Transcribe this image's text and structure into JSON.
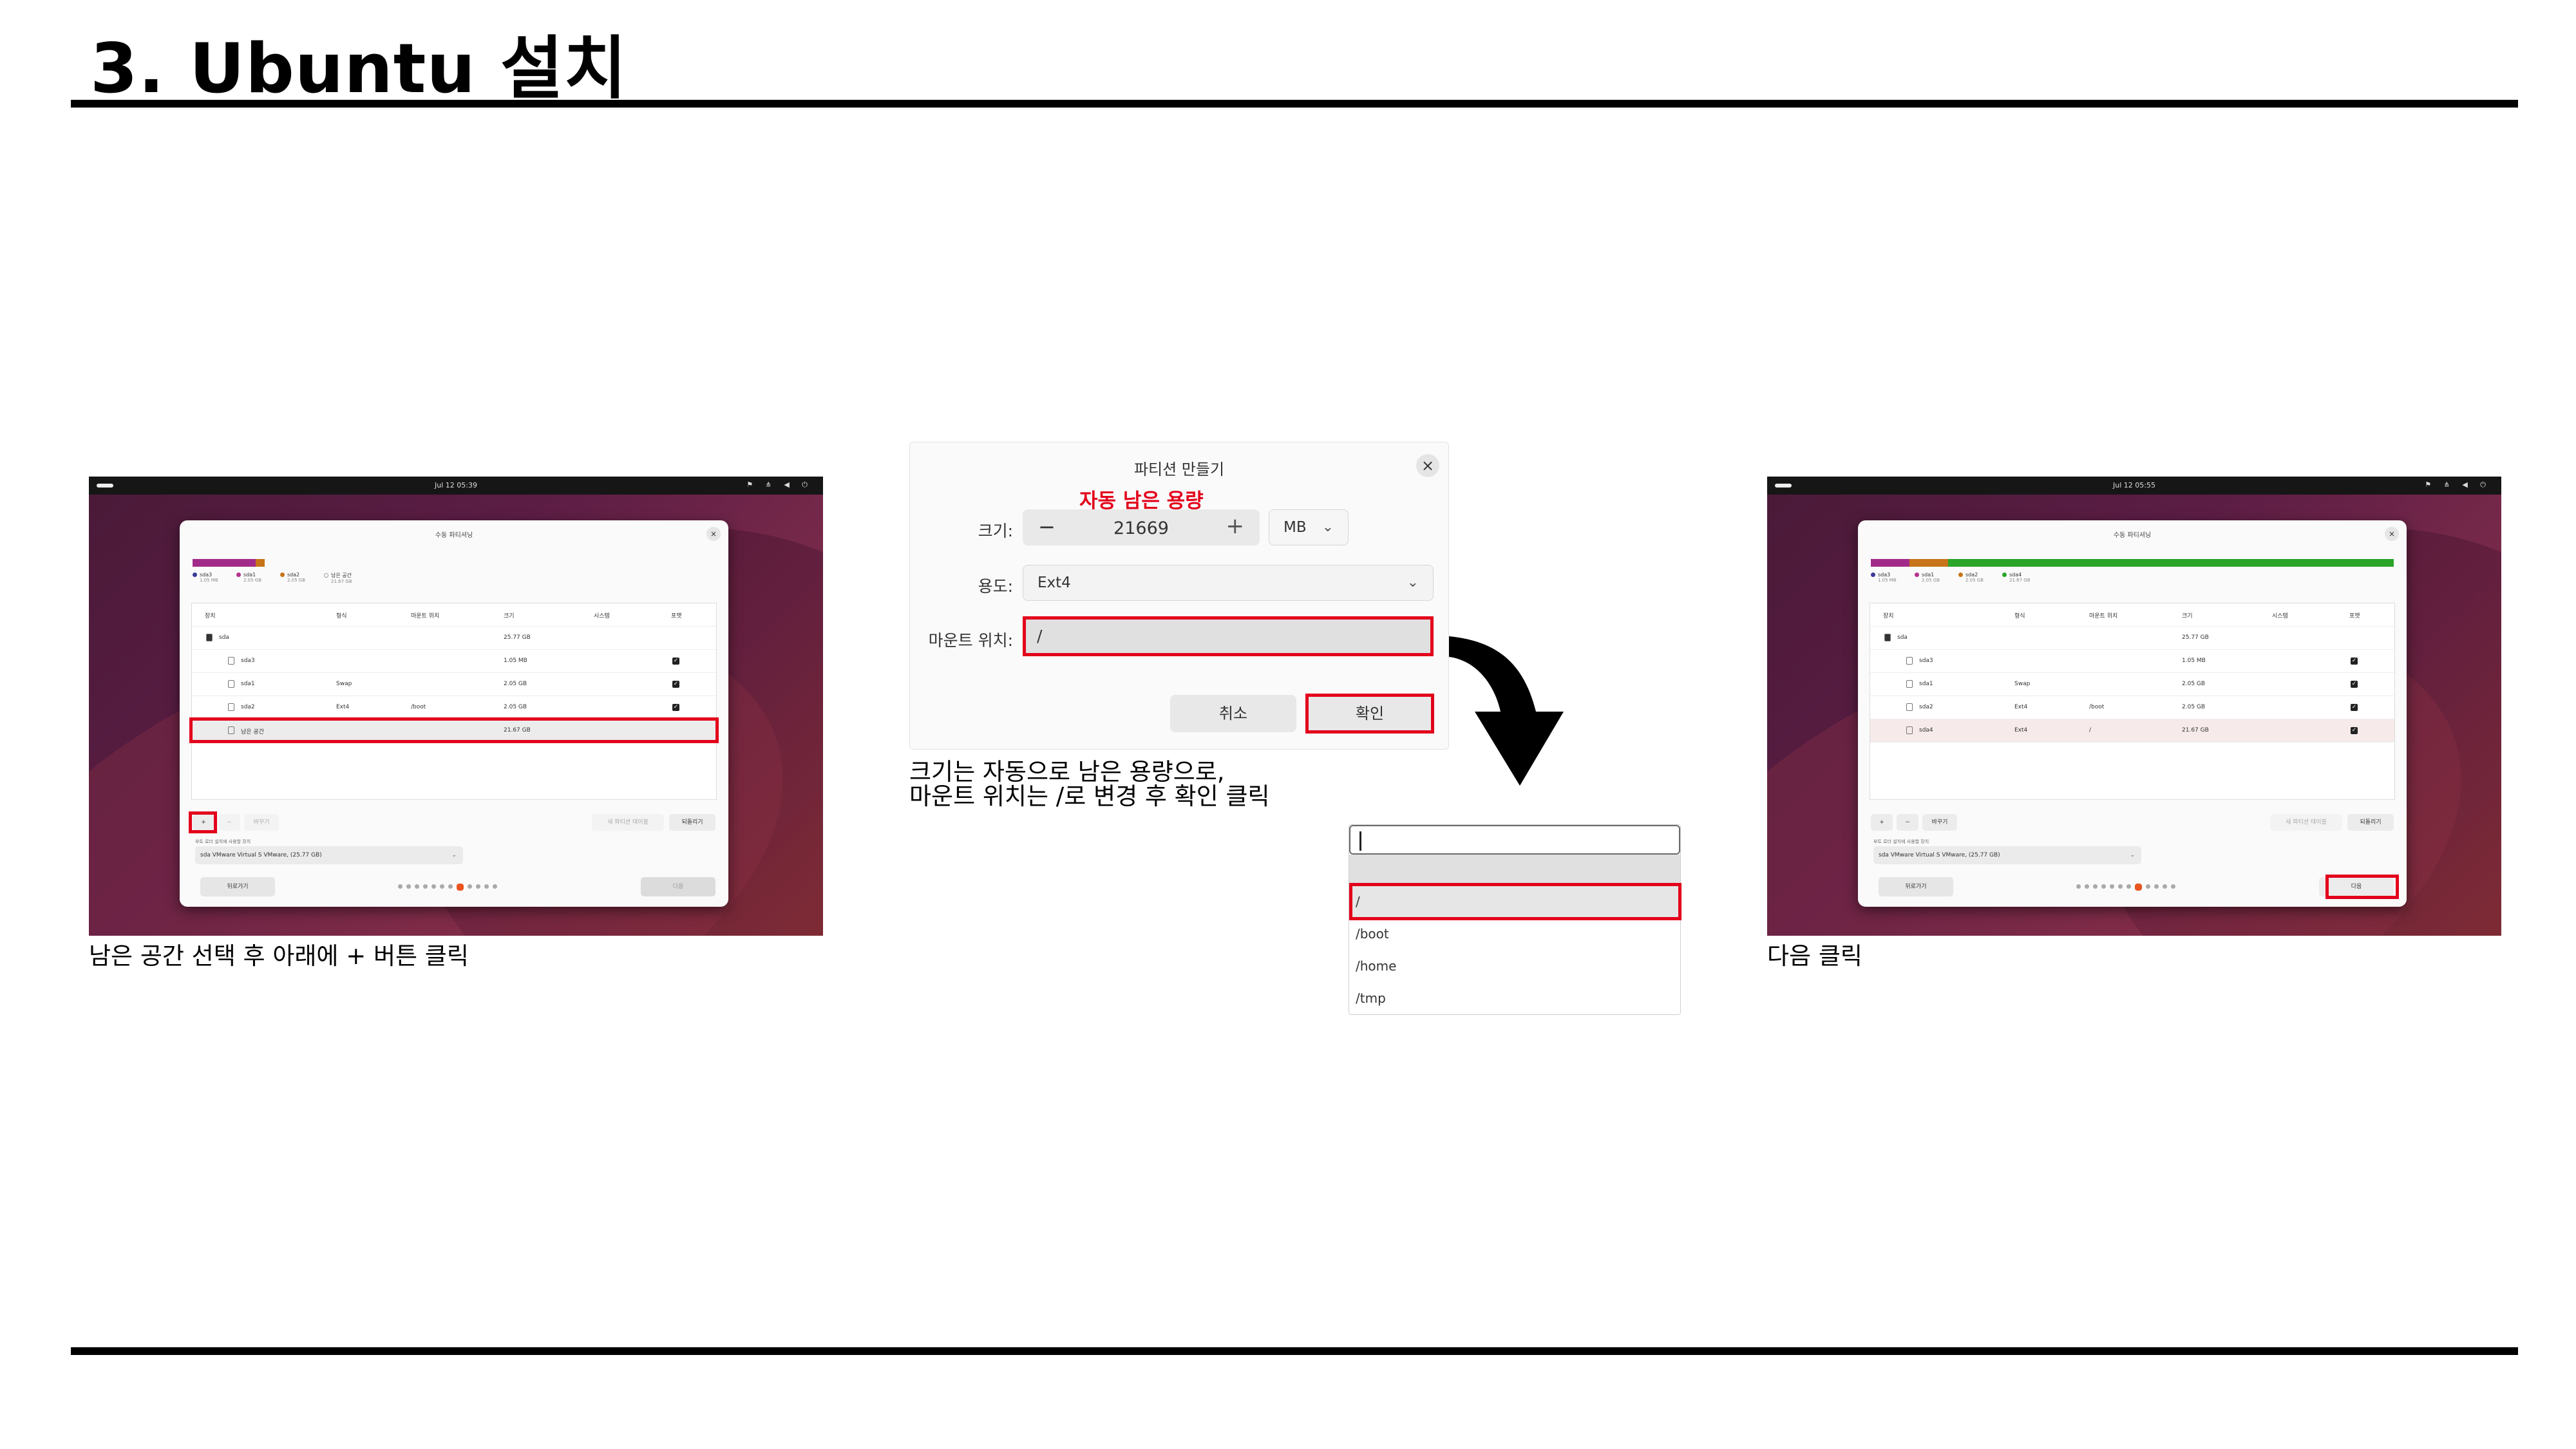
{
  "slide": {
    "title": "3. Ubuntu 설치"
  },
  "left_shot": {
    "clock": "Jul 12 05:39",
    "window_title": "수동 파티셔닝",
    "legend": [
      {
        "name": "sda3",
        "size": "1.05 MB",
        "color": "#8e2a8c"
      },
      {
        "name": "sda1",
        "size": "2.05 GB",
        "color": "#b5318d"
      },
      {
        "name": "sda2",
        "size": "2.05 GB",
        "color": "#c7741a"
      },
      {
        "name": "남은 공간",
        "size": "21.67 GB",
        "color": "#ffffff"
      }
    ],
    "headers": [
      "장치",
      "형식",
      "마운트 위치",
      "크기",
      "시스템",
      "포맷"
    ],
    "rows": [
      {
        "device": "sda",
        "type": "",
        "mount": "",
        "size": "25.77 GB",
        "check": false
      },
      {
        "device": "sda3",
        "type": "",
        "mount": "",
        "size": "1.05 MB",
        "check": true
      },
      {
        "device": "sda1",
        "type": "Swap",
        "mount": "",
        "size": "2.05 GB",
        "check": true
      },
      {
        "device": "sda2",
        "type": "Ext4",
        "mount": "/boot",
        "size": "2.05 GB",
        "check": true
      },
      {
        "device": "남은 공간",
        "type": "",
        "mount": "",
        "size": "21.67 GB",
        "check": false
      }
    ],
    "buttons": {
      "add": "+",
      "remove": "−",
      "change": "바꾸기",
      "new_table": "새 파티션 테이블",
      "revert": "되돌리기"
    },
    "boot_label": "부트 로더 설치에 사용할 장치",
    "boot_device": "sda VMware Virtual S VMware, (25.77 GB)",
    "back": "뒤로가기",
    "next": "다음"
  },
  "left_caption": "남은 공간 선택 후 아래에 + 버튼 클릭",
  "dialog": {
    "title": "파티션 만들기",
    "auto_note": "자동 남은 용량",
    "size_label": "크기:",
    "size_value": "21669",
    "minus": "−",
    "plus": "+",
    "unit": "MB",
    "use_label": "용도:",
    "use_value": "Ext4",
    "mount_label": "마운트 위치:",
    "mount_value": "/",
    "cancel": "취소",
    "ok": "확인"
  },
  "middle_caption": [
    "크기는 자동으로 남은 용량으로,",
    "마운트 위치는 /로 변경 후 확인 클릭"
  ],
  "dropdown": {
    "options": [
      "/",
      "/boot",
      "/home",
      "/tmp"
    ]
  },
  "right_shot": {
    "clock": "Jul 12 05:55",
    "window_title": "수동 파티셔닝",
    "legend": [
      {
        "name": "sda3",
        "size": "1.05 MB",
        "color": "#8e2a8c"
      },
      {
        "name": "sda1",
        "size": "2.05 GB",
        "color": "#b5318d"
      },
      {
        "name": "sda2",
        "size": "2.05 GB",
        "color": "#c7741a"
      },
      {
        "name": "sda4",
        "size": "21.67 GB",
        "color": "#2aa52a"
      }
    ],
    "headers": [
      "장치",
      "형식",
      "마운트 위치",
      "크기",
      "시스템",
      "포맷"
    ],
    "rows": [
      {
        "device": "sda",
        "type": "",
        "mount": "",
        "size": "25.77 GB",
        "check": false
      },
      {
        "device": "sda3",
        "type": "",
        "mount": "",
        "size": "1.05 MB",
        "check": true
      },
      {
        "device": "sda1",
        "type": "Swap",
        "mount": "",
        "size": "2.05 GB",
        "check": true
      },
      {
        "device": "sda2",
        "type": "Ext4",
        "mount": "/boot",
        "size": "2.05 GB",
        "check": true
      },
      {
        "device": "sda4",
        "type": "Ext4",
        "mount": "/",
        "size": "21.67 GB",
        "check": true
      }
    ],
    "buttons": {
      "add": "+",
      "remove": "−",
      "change": "바꾸기",
      "new_table": "새 파티션 테이블",
      "revert": "되돌리기"
    },
    "boot_label": "부트 로더 설치에 사용할 장치",
    "boot_device": "sda VMware Virtual S VMware, (25.77 GB)",
    "back": "뒤로가기",
    "next": "다음"
  },
  "right_caption": "다음 클릭"
}
